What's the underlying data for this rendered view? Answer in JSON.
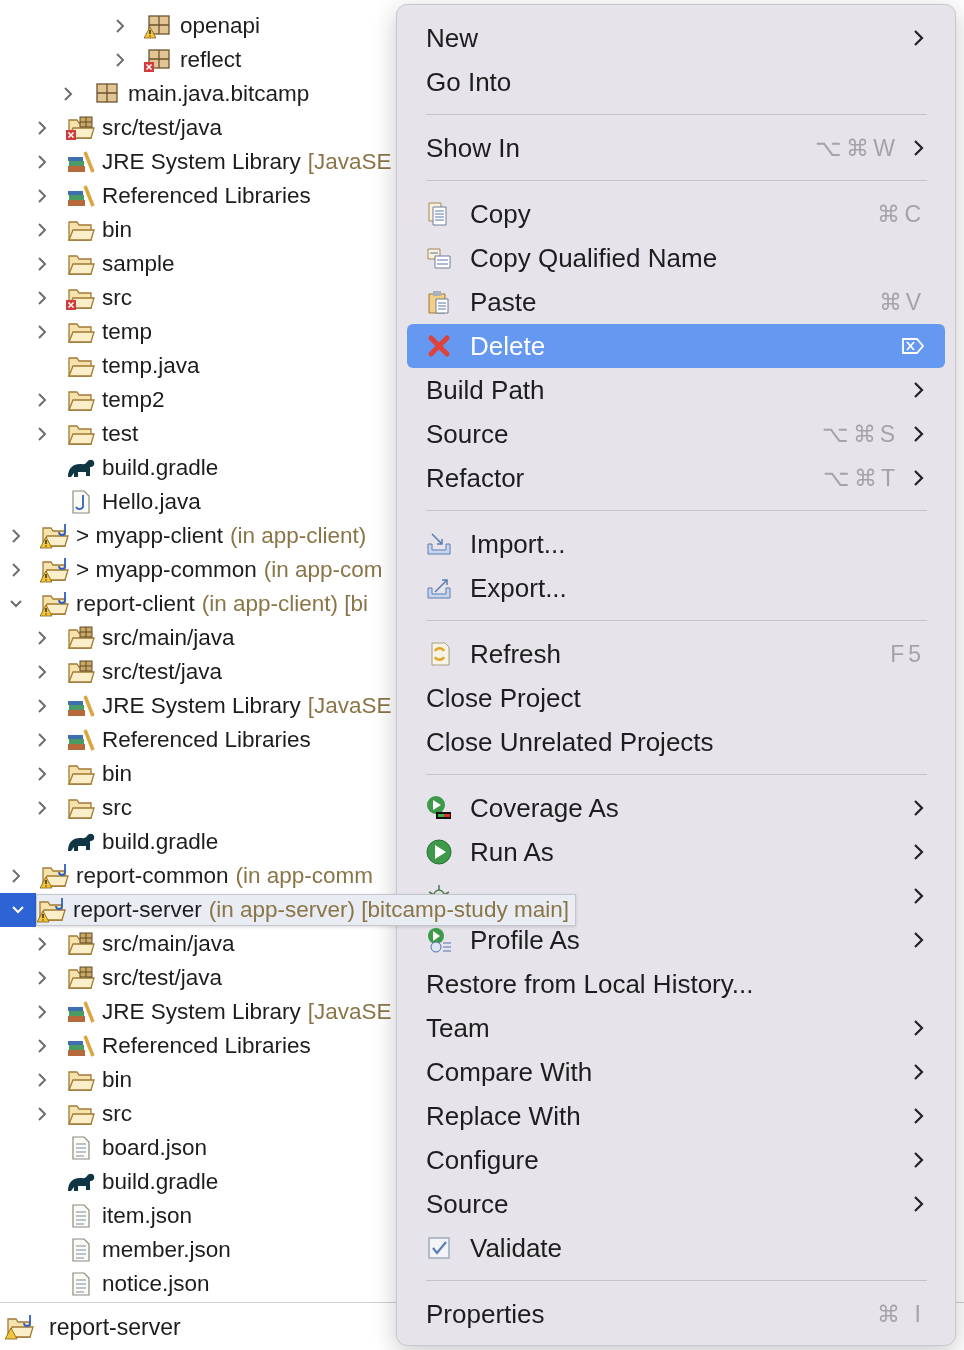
{
  "tree": {
    "items": [
      {
        "children": [
          {
            "children": [
              {
                "children": [
                  {
                    "children": [
                      {
                        "label": "openapi",
                        "kind": "package",
                        "warning": true,
                        "expandable": true,
                        "expanded": false,
                        "selected": false
                      },
                      {
                        "label": "reflect",
                        "kind": "package",
                        "error": true,
                        "expandable": true,
                        "expanded": false,
                        "selected": false
                      }
                    ]
                  }
                ]
              },
              {
                "label": "main.java.bitcamp",
                "kind": "package",
                "expandable": true,
                "expanded": false,
                "selected": false
              }
            ]
          },
          {
            "label": "src/test/java",
            "kind": "source-folder",
            "error": true,
            "expandable": true,
            "expanded": false,
            "selected": false
          },
          {
            "label": "JRE System Library",
            "note": "[JavaSE",
            "kind": "library",
            "expandable": true,
            "expanded": false,
            "selected": false
          },
          {
            "label": "Referenced Libraries",
            "kind": "library",
            "expandable": true,
            "expanded": false,
            "selected": false
          },
          {
            "label": "bin",
            "kind": "folder",
            "expandable": true,
            "expanded": false,
            "selected": false
          },
          {
            "label": "sample",
            "kind": "folder",
            "expandable": true,
            "expanded": false,
            "selected": false
          },
          {
            "label": "src",
            "kind": "folder",
            "error": true,
            "expandable": true,
            "expanded": false,
            "selected": false
          },
          {
            "label": "temp",
            "kind": "folder",
            "expandable": true,
            "expanded": false,
            "selected": false
          },
          {
            "label": "temp.java",
            "kind": "folder",
            "expandable": false,
            "selected": false
          },
          {
            "label": "temp2",
            "kind": "folder",
            "expandable": true,
            "expanded": false,
            "selected": false
          },
          {
            "label": "test",
            "kind": "folder",
            "expandable": true,
            "expanded": false,
            "selected": false
          },
          {
            "label": "build.gradle",
            "kind": "gradle-file",
            "expandable": false,
            "selected": false
          },
          {
            "label": "Hello.java",
            "kind": "java-file",
            "expandable": false,
            "selected": false
          }
        ]
      },
      {
        "label": "> myapp-client",
        "note": "(in app-client)",
        "kind": "project",
        "warning": true,
        "expandable": true,
        "expanded": false,
        "selected": false
      },
      {
        "label": "> myapp-common",
        "note": "(in app-com",
        "kind": "project",
        "warning": true,
        "expandable": true,
        "expanded": false,
        "selected": false
      },
      {
        "label": "report-client",
        "note": "(in app-client) [bi",
        "kind": "project",
        "warning": true,
        "expandable": true,
        "expanded": true,
        "selected": false,
        "children": [
          {
            "label": "src/main/java",
            "kind": "source-folder",
            "expandable": true,
            "expanded": false,
            "selected": false
          },
          {
            "label": "src/test/java",
            "kind": "source-folder",
            "expandable": true,
            "expanded": false,
            "selected": false
          },
          {
            "label": "JRE System Library",
            "note": "[JavaSE",
            "kind": "library",
            "expandable": true,
            "expanded": false,
            "selected": false
          },
          {
            "label": "Referenced Libraries",
            "kind": "library",
            "expandable": true,
            "expanded": false,
            "selected": false
          },
          {
            "label": "bin",
            "kind": "folder",
            "expandable": true,
            "expanded": false,
            "selected": false
          },
          {
            "label": "src",
            "kind": "folder",
            "expandable": true,
            "expanded": false,
            "selected": false
          },
          {
            "label": "build.gradle",
            "kind": "gradle-file",
            "expandable": false,
            "selected": false
          }
        ]
      },
      {
        "label": "report-common",
        "note": "(in app-comm",
        "kind": "project",
        "warning": true,
        "expandable": true,
        "expanded": false,
        "selected": false
      },
      {
        "label": "report-server",
        "note": "(in app-server) [bitcamp-study main]",
        "kind": "project",
        "warning": true,
        "expandable": true,
        "expanded": true,
        "selected": true,
        "children": [
          {
            "label": "src/main/java",
            "kind": "source-folder",
            "expandable": true,
            "expanded": false,
            "selected": false
          },
          {
            "label": "src/test/java",
            "kind": "source-folder",
            "expandable": true,
            "expanded": false,
            "selected": false
          },
          {
            "label": "JRE System Library",
            "note": "[JavaSE",
            "kind": "library",
            "expandable": true,
            "expanded": false,
            "selected": false
          },
          {
            "label": "Referenced Libraries",
            "kind": "library",
            "expandable": true,
            "expanded": false,
            "selected": false
          },
          {
            "label": "bin",
            "kind": "folder",
            "expandable": true,
            "expanded": false,
            "selected": false
          },
          {
            "label": "src",
            "kind": "folder",
            "expandable": true,
            "expanded": false,
            "selected": false
          },
          {
            "label": "board.json",
            "kind": "json-file",
            "expandable": false,
            "selected": false
          },
          {
            "label": "build.gradle",
            "kind": "gradle-file",
            "expandable": false,
            "selected": false
          },
          {
            "label": "item.json",
            "kind": "json-file",
            "expandable": false,
            "selected": false
          },
          {
            "label": "member.json",
            "kind": "json-file",
            "expandable": false,
            "selected": false
          },
          {
            "label": "notice.json",
            "kind": "json-file",
            "expandable": false,
            "selected": false
          }
        ]
      }
    ]
  },
  "status_bar": {
    "label": "report-server"
  },
  "menu": {
    "items": [
      {
        "kind": "plain",
        "label": "New",
        "submenu": true,
        "selected": false
      },
      {
        "kind": "plain",
        "label": "Go Into",
        "submenu": false,
        "selected": false
      },
      {
        "kind": "separator"
      },
      {
        "kind": "plain",
        "label": "Show In",
        "shortcut": "⌥⌘W",
        "submenu": true,
        "selected": false
      },
      {
        "kind": "separator"
      },
      {
        "kind": "copy",
        "label": "Copy",
        "shortcut": "⌘C",
        "submenu": false,
        "selected": false
      },
      {
        "kind": "copyname",
        "label": "Copy Qualified Name",
        "submenu": false,
        "selected": false
      },
      {
        "kind": "paste",
        "label": "Paste",
        "shortcut": "⌘V",
        "submenu": false,
        "selected": false
      },
      {
        "kind": "delete",
        "label": "Delete",
        "trailing_icon": true,
        "submenu": false,
        "selected": true
      },
      {
        "kind": "plain",
        "label": "Build Path",
        "submenu": true,
        "selected": false
      },
      {
        "kind": "plain",
        "label": "Source",
        "shortcut": "⌥⌘S",
        "submenu": true,
        "selected": false
      },
      {
        "kind": "plain",
        "label": "Refactor",
        "shortcut": "⌥⌘T",
        "submenu": true,
        "selected": false
      },
      {
        "kind": "separator"
      },
      {
        "kind": "import",
        "label": "Import...",
        "submenu": false,
        "selected": false
      },
      {
        "kind": "export",
        "label": "Export...",
        "submenu": false,
        "selected": false
      },
      {
        "kind": "separator"
      },
      {
        "kind": "refresh",
        "label": "Refresh",
        "shortcut": "F5",
        "submenu": false,
        "selected": false
      },
      {
        "kind": "plain",
        "label": "Close Project",
        "submenu": false,
        "selected": false
      },
      {
        "kind": "plain",
        "label": "Close Unrelated Projects",
        "submenu": false,
        "selected": false
      },
      {
        "kind": "separator"
      },
      {
        "kind": "coverage",
        "label": "Coverage As",
        "submenu": true,
        "selected": false
      },
      {
        "kind": "run",
        "label": "Run As",
        "submenu": true,
        "selected": false
      },
      {
        "kind": "debug",
        "submenu": true,
        "selected": false
      },
      {
        "kind": "profile",
        "label": "Profile As",
        "submenu": true,
        "selected": false
      },
      {
        "kind": "plain",
        "label": "Restore from Local History...",
        "submenu": false,
        "selected": false
      },
      {
        "kind": "plain",
        "label": "Team",
        "submenu": true,
        "selected": false
      },
      {
        "kind": "plain",
        "label": "Compare With",
        "submenu": true,
        "selected": false
      },
      {
        "kind": "plain",
        "label": "Replace With",
        "submenu": true,
        "selected": false
      },
      {
        "kind": "plain",
        "label": "Configure",
        "submenu": true,
        "selected": false
      },
      {
        "kind": "plain",
        "label": "Source",
        "submenu": true,
        "selected": false
      },
      {
        "kind": "check",
        "label": "Validate",
        "checked": true,
        "submenu": false,
        "selected": false
      },
      {
        "kind": "separator"
      },
      {
        "kind": "plain",
        "label": "Properties",
        "shortcut": "⌘ I",
        "submenu": false,
        "selected": false
      }
    ]
  }
}
